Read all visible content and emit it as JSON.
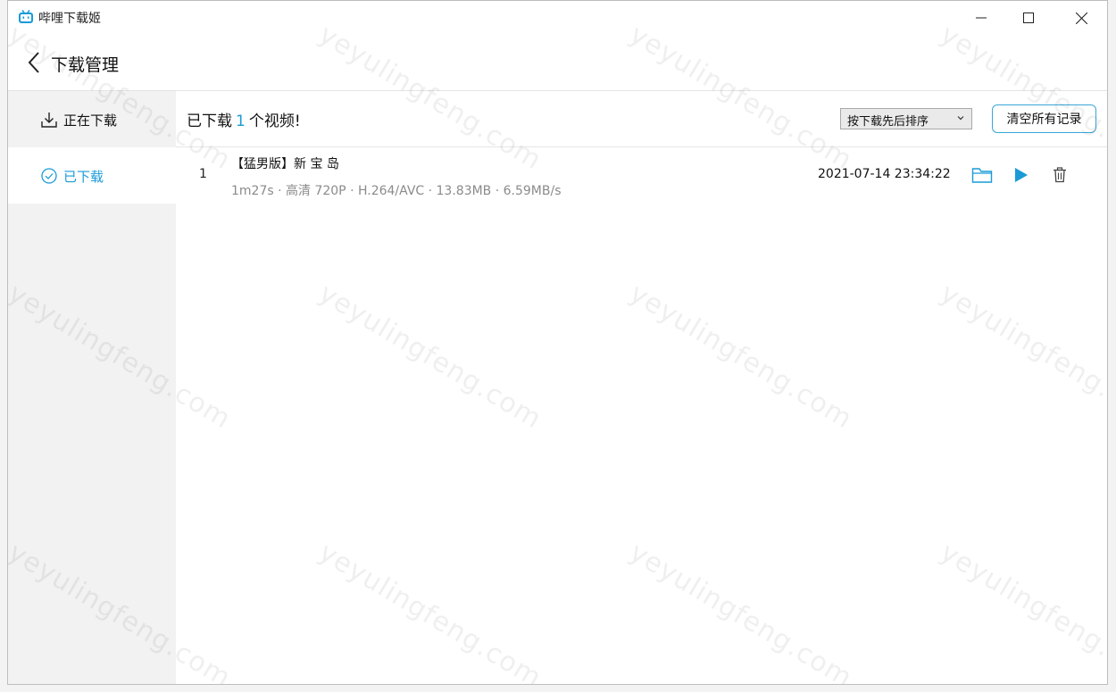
{
  "window": {
    "title": "哔哩下载姬"
  },
  "header": {
    "title": "下载管理"
  },
  "sidebar": {
    "items": [
      {
        "label": "正在下载",
        "icon": "download-icon",
        "active": false
      },
      {
        "label": "已下载",
        "icon": "check-circle-icon",
        "active": true
      }
    ]
  },
  "main": {
    "count_prefix": "已下载",
    "count_value": "1",
    "count_suffix": "个视频!",
    "sort": {
      "selected": "按下载先后排序"
    },
    "clear_label": "清空所有记录",
    "items": [
      {
        "index": "1",
        "title": "【猛男版】新 宝 岛",
        "meta": "1m27s · 高清 720P · H.264/AVC · 13.83MB · 6.59MB/s",
        "date": "2021-07-14 23:34:22"
      }
    ]
  },
  "watermark": "yeyulingfeng.com",
  "colors": {
    "accent": "#1a9bd7",
    "sidebar_bg": "#f2f2f2",
    "meta_text": "#8b8b8b"
  }
}
